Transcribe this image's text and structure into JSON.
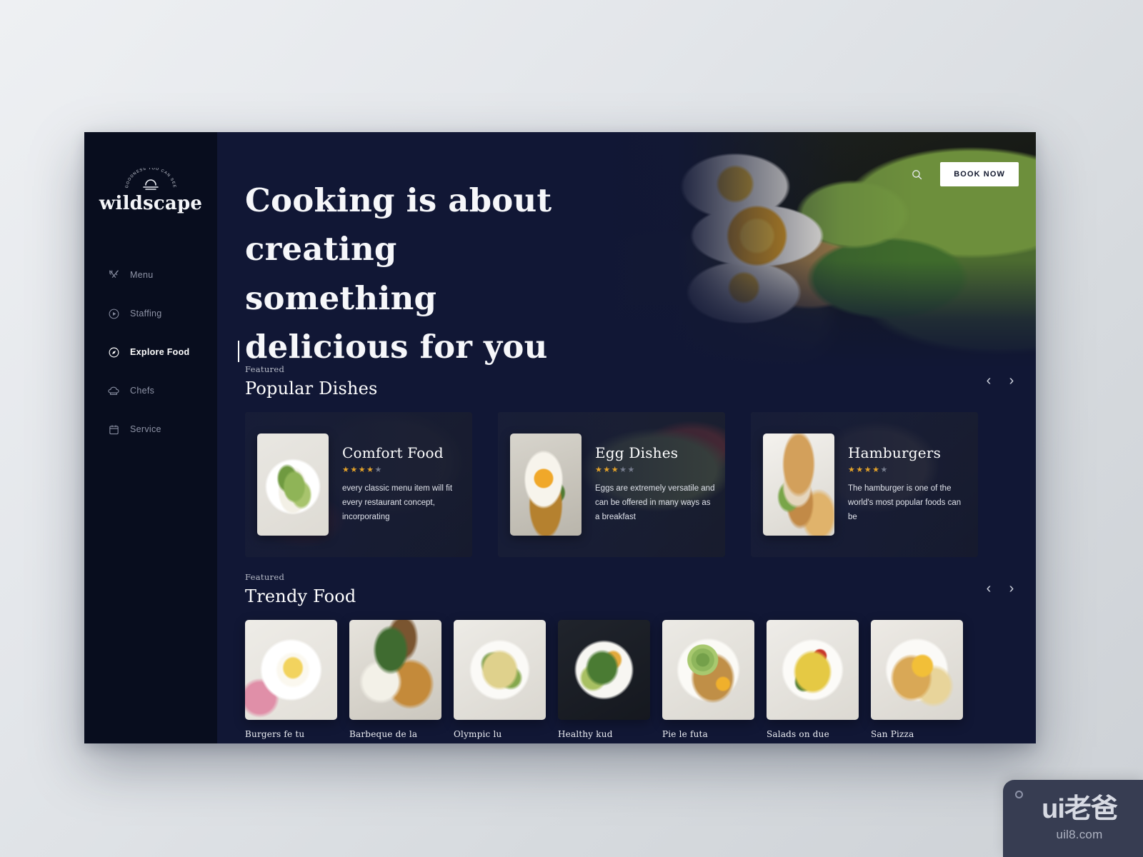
{
  "brand": {
    "name": "wildscape",
    "tagline_arc": "GOODNESS YOU CAN SEE"
  },
  "sidebar": {
    "items": [
      {
        "label": "Menu",
        "icon": "fork-knife-icon",
        "active": false
      },
      {
        "label": "Staffing",
        "icon": "play-circle-icon",
        "active": false
      },
      {
        "label": "Explore Food",
        "icon": "compass-icon",
        "active": true
      },
      {
        "label": "Chefs",
        "icon": "chef-hat-icon",
        "active": false
      },
      {
        "label": "Service",
        "icon": "calendar-icon",
        "active": false
      }
    ]
  },
  "topbar": {
    "search_icon": "search-icon",
    "book_label": "BOOK NOW"
  },
  "hero": {
    "heading": "Cooking is about creating something delicious for you"
  },
  "popular": {
    "eyebrow": "Featured",
    "title": "Popular Dishes",
    "prev": "‹",
    "next": "›",
    "cards": [
      {
        "title": "Comfort Food",
        "rating": 4,
        "max_rating": 5,
        "description": "every classic menu item will fit every restaurant concept, incorporating"
      },
      {
        "title": "Egg Dishes",
        "rating": 3,
        "max_rating": 5,
        "description": "Eggs are extremely versatile and can be offered in many ways as a breakfast"
      },
      {
        "title": "Hamburgers",
        "rating": 4,
        "max_rating": 5,
        "description": "The hamburger is one of the world's most popular foods can be"
      }
    ]
  },
  "trendy": {
    "eyebrow": "Featured",
    "title": "Trendy Food",
    "prev": "‹",
    "next": "›",
    "items": [
      {
        "label": "Burgers fe tu"
      },
      {
        "label": "Barbeque de la"
      },
      {
        "label": "Olympic lu"
      },
      {
        "label": "Healthy kud"
      },
      {
        "label": "Pie le futa"
      },
      {
        "label": "Salads on due"
      },
      {
        "label": "San Pizza"
      }
    ]
  },
  "watermark": {
    "main": "ui老爸",
    "sub": "uil8.com"
  },
  "colors": {
    "app_bg": "#111735",
    "sidebar_bg": "#080d1e",
    "star_on": "#e3a22a",
    "star_off": "#767c8d",
    "accent_white": "#ffffff"
  }
}
